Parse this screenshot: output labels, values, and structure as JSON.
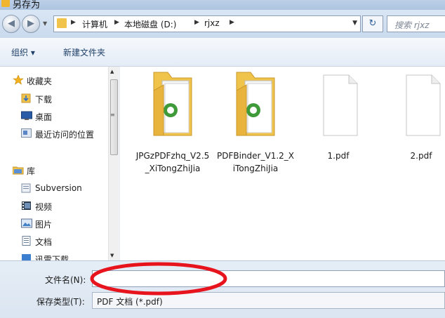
{
  "window": {
    "title": "另存为"
  },
  "nav": {
    "address": [
      "计算机",
      "本地磁盘 (D:)",
      "rjxz"
    ],
    "search_placeholder": "搜索 rjxz"
  },
  "toolbar": {
    "organize": "组织 ▾",
    "new_folder": "新建文件夹"
  },
  "sidebar": {
    "favorites": "收藏夹",
    "fav_items": [
      "下载",
      "桌面",
      "最近访问的位置"
    ],
    "libraries": "库",
    "lib_items": [
      "Subversion",
      "视频",
      "图片",
      "文档",
      "迅雷下载"
    ]
  },
  "files": [
    {
      "name": "JPGzPDFzhq_V2.5_XiTongZhiJia",
      "type": "folder"
    },
    {
      "name": "PDFBinder_V1.2_XiTongZhiJia",
      "type": "folder"
    },
    {
      "name": "1.pdf",
      "type": "file"
    },
    {
      "name": "2.pdf",
      "type": "file"
    }
  ],
  "form": {
    "filename_label": "文件名(N):",
    "filename_value": "",
    "filetype_label": "保存类型(T):",
    "filetype_value": "PDF 文档 (*.pdf)"
  },
  "colors": {
    "annotation": "#e8141d",
    "folder": "#f0c34a"
  }
}
